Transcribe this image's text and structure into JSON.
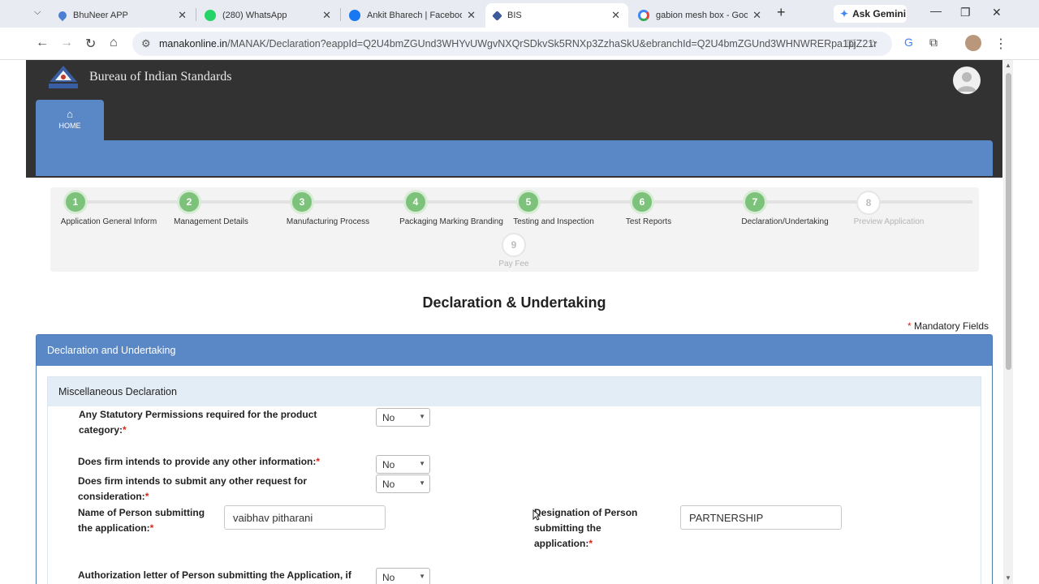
{
  "browser": {
    "tabs": [
      {
        "label": "BhuNeer APP",
        "icon": "water-drop-icon",
        "color": "#4a7fd4"
      },
      {
        "label": "(280) WhatsApp",
        "icon": "whatsapp-icon",
        "color": "#25d366"
      },
      {
        "label": "Ankit Bharech | Facebook",
        "icon": "facebook-icon",
        "color": "#1877f2"
      },
      {
        "label": "BIS",
        "icon": "bis-icon",
        "color": "#3b5b9a"
      },
      {
        "label": "gabion mesh box - Google",
        "icon": "google-icon",
        "color": "#4285f4"
      }
    ],
    "gemini_label": "Ask Gemini",
    "url_host": "manakonline.in",
    "url_path": "/MANAK/Declaration?eappId=Q2U4bmZGUnd3WHYvUWgvNXQrSDkvSk5RNXp3ZzhaSkU&ebranchId=Q2U4bmZGUnd3WHNWRERpa1pjZ21nQ..."
  },
  "header": {
    "org_title": "Bureau of Indian Standards",
    "home_label": "HOME"
  },
  "wizard": {
    "steps": [
      {
        "num": "1",
        "label": "Application General Inform",
        "done": true
      },
      {
        "num": "2",
        "label": "Management Details",
        "done": true
      },
      {
        "num": "3",
        "label": "Manufacturing Process",
        "done": true
      },
      {
        "num": "4",
        "label": "Packaging Marking Branding",
        "done": true
      },
      {
        "num": "5",
        "label": "Testing and Inspection",
        "done": true
      },
      {
        "num": "6",
        "label": "Test Reports",
        "done": true
      },
      {
        "num": "7",
        "label": "Declaration/Undertaking",
        "done": true
      },
      {
        "num": "8",
        "label": "Preview Application",
        "done": false
      },
      {
        "num": "9",
        "label": "Pay Fee",
        "done": false
      }
    ]
  },
  "main": {
    "title": "Declaration & Undertaking",
    "mandatory_note": "Mandatory Fields",
    "panel_title": "Declaration and Undertaking",
    "subpanel_title": "Miscellaneous Declaration",
    "questions": {
      "q1": "Any Statutory Permissions required for the product category:",
      "q2": "Does firm intends to provide any other information:",
      "q3": "Does firm intends to submit any other request for consideration:",
      "q4": "Name of Person submitting the application:",
      "q5": "Designation of Person submitting the application:",
      "q6": "Authorization letter of Person submitting the Application, if"
    },
    "values": {
      "q1": "No",
      "q2": "No",
      "q3": "No",
      "name": "vaibhav pitharani",
      "designation": "PARTNERSHIP",
      "q6": "No"
    }
  }
}
